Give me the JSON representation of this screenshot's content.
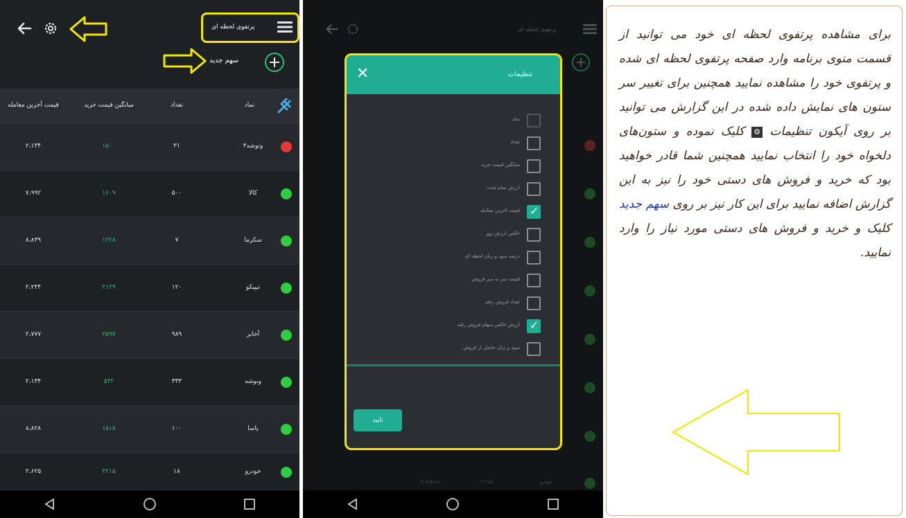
{
  "panel1": {
    "header_title": "پرتفوی لحظه ای",
    "new_stock_label": "سهم جدید",
    "columns": [
      "قیمت آخرین معامله",
      "میانگین قیمت خرید",
      "تعداد",
      "نماد"
    ],
    "rows": [
      {
        "status": "red",
        "symbol": "وتوشه۳",
        "count": "۳۱",
        "avg": "۱۵۰۰",
        "last": "۲،۱۳۴"
      },
      {
        "status": "green",
        "symbol": "کالا",
        "count": "۵۰۰",
        "avg": "۱۶۰۹",
        "last": "۷،۹۹۲"
      },
      {
        "status": "green",
        "symbol": "سکرما",
        "count": "۷",
        "avg": "۱۲۲۸",
        "last": "۸،۸۳۹"
      },
      {
        "status": "green",
        "symbol": "تیپیکو",
        "count": "۱۲۰",
        "avg": "۲۱۲۹",
        "last": "۲،۲۴۴"
      },
      {
        "status": "green",
        "symbol": "آخابر",
        "count": "۹۸۹",
        "avg": "۲۵۹۷",
        "last": "۲،۷۷۷"
      },
      {
        "status": "green",
        "symbol": "ونوشه",
        "count": "۳۳۳",
        "avg": "۵۳۲",
        "last": "۲،۱۳۴"
      },
      {
        "status": "green",
        "symbol": "پاسا",
        "count": "۱۰۰",
        "avg": "۱۵۱۸",
        "last": "۸،۸۲۸"
      },
      {
        "status": "green",
        "symbol": "خودرو",
        "count": "۱۸",
        "avg": "۲۲۱۵",
        "last": "۲،۶۲۵"
      }
    ]
  },
  "panel2": {
    "header_title": "پرتفوی لحظه ای",
    "dialog_title": "تنظیمات",
    "confirm_label": "تایید",
    "options": [
      {
        "label": "نماد",
        "checked": false,
        "disabled": true
      },
      {
        "label": "تعداد",
        "checked": false,
        "disabled": false
      },
      {
        "label": "میانگین قیمت خرید",
        "checked": false,
        "disabled": false
      },
      {
        "label": "ارزش تمام شده",
        "checked": false,
        "disabled": false
      },
      {
        "label": "قیمت آخرین معامله",
        "checked": true,
        "disabled": false
      },
      {
        "label": "خالص ارزش روز",
        "checked": false,
        "disabled": false
      },
      {
        "label": "درصد سود و زیان لحظه ای",
        "checked": false,
        "disabled": false
      },
      {
        "label": "قیمت سر به سر فروش",
        "checked": false,
        "disabled": false
      },
      {
        "label": "تعداد فروش رفته",
        "checked": false,
        "disabled": false
      },
      {
        "label": "ارزش خالص سهام فروش رفته",
        "checked": true,
        "disabled": false
      },
      {
        "label": "سود و زیان حاصل از فروش",
        "checked": false,
        "disabled": false
      }
    ],
    "bottom_row": {
      "symbol": "خودرو",
      "v1": "۲،۲۱۵",
      "v2": "۳،۶۲۵،۱۷"
    }
  },
  "panel3": {
    "text_part1": "برای مشاهده پرتفوی لحظه ای خود می توانید از قسمت منوی برنامه وارد صفحه پرتفوی لحظه ای شده و پرتفوی خود را مشاهده نمایید همچنین برای تغییر سر ستون های نمایش داده شده در این گزارش می توانید بر روی آیکون تنظیمات",
    "gear_glyph": "⚙",
    "text_part2": "کلیک نموده و ستون‌های دلخواه خود را انتخاب نمایید همچنین شما قادر خواهید بود که خرید و فروش های دستی خود را نیز به این گزارش اضافه نمایید برای این کار نیز بر روی",
    "link_text": "سهم جدید",
    "text_part3": "کلیک و خرید و فروش های دستی مورد نیاز را وارد نمایید."
  },
  "colors": {
    "accent": "#1fae93",
    "highlight": "#f3e600",
    "status_green": "#2ecc40",
    "status_red": "#e53935"
  }
}
